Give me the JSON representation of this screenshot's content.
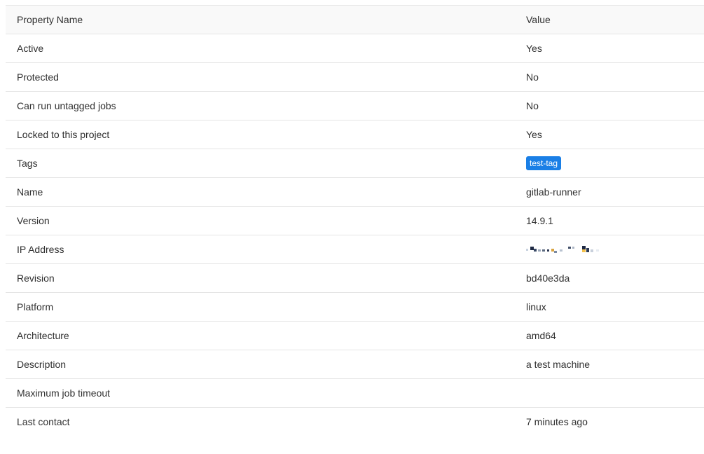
{
  "table": {
    "headers": {
      "property": "Property Name",
      "value": "Value"
    },
    "rows": [
      {
        "property": "Active",
        "value": "Yes"
      },
      {
        "property": "Protected",
        "value": "No"
      },
      {
        "property": "Can run untagged jobs",
        "value": "No"
      },
      {
        "property": "Locked to this project",
        "value": "Yes"
      },
      {
        "property": "Tags",
        "tag": "test-tag"
      },
      {
        "property": "Name",
        "value": "gitlab-runner"
      },
      {
        "property": "Version",
        "value": "14.9.1"
      },
      {
        "property": "IP Address",
        "redacted": true
      },
      {
        "property": "Revision",
        "value": "bd40e3da"
      },
      {
        "property": "Platform",
        "value": "linux"
      },
      {
        "property": "Architecture",
        "value": "amd64"
      },
      {
        "property": "Description",
        "value": "a test machine"
      },
      {
        "property": "Maximum job timeout",
        "value": ""
      },
      {
        "property": "Last contact",
        "value": "7 minutes ago"
      }
    ]
  },
  "colors": {
    "tag_badge": "#1a7fe6",
    "header_bg": "#f9f9f9",
    "row_border": "#e5e5e5"
  }
}
